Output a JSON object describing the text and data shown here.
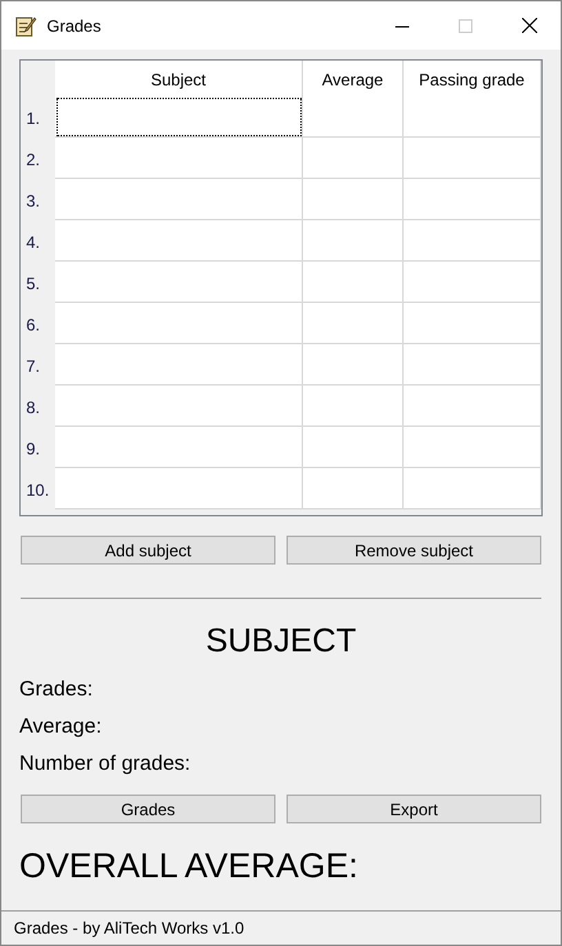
{
  "window": {
    "title": "Grades"
  },
  "table": {
    "columns": [
      "Subject",
      "Average",
      "Passing grade"
    ],
    "rows": [
      {
        "label": "1.",
        "focused": true
      },
      {
        "label": "2.",
        "focused": false
      },
      {
        "label": "3.",
        "focused": false
      },
      {
        "label": "4.",
        "focused": false
      },
      {
        "label": "5.",
        "focused": false
      },
      {
        "label": "6.",
        "focused": false
      },
      {
        "label": "7.",
        "focused": false
      },
      {
        "label": "8.",
        "focused": false
      },
      {
        "label": "9.",
        "focused": false
      },
      {
        "label": "10.",
        "focused": false
      }
    ]
  },
  "table_buttons": [
    "Add subject",
    "Remove subject"
  ],
  "subject": {
    "heading": "SUBJECT",
    "fields": [
      "Grades:",
      "Average:",
      "Number of grades:"
    ]
  },
  "subject_buttons": [
    "Grades",
    "Export"
  ],
  "overall": "OVERALL AVERAGE:",
  "status_bar": "Grades - by AliTech Works v1.0"
}
